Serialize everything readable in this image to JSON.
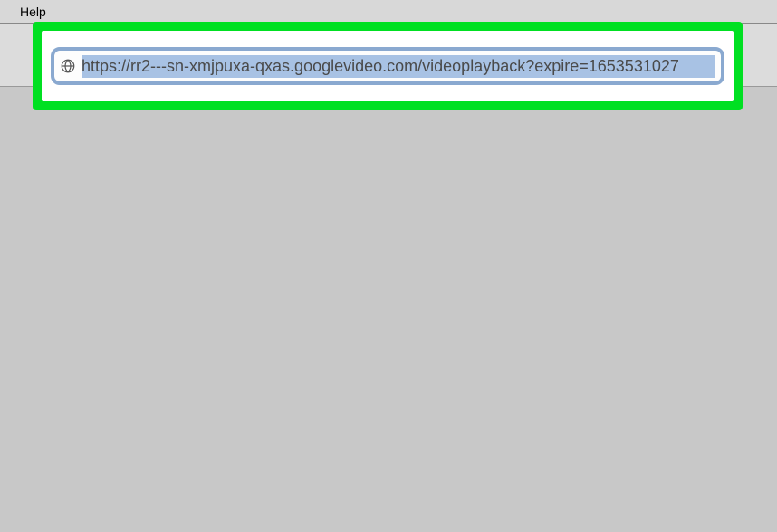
{
  "menubar": {
    "help_label": "Help"
  },
  "urlbar": {
    "url_value": "https://rr2---sn-xmjpuxa-qxas.googlevideo.com/videoplayback?expire=1653531027"
  }
}
